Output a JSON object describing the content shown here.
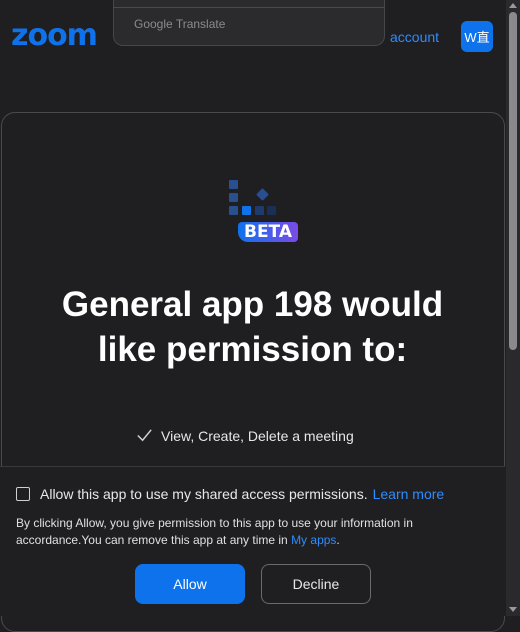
{
  "header": {
    "logo_text": "zoom",
    "translate_label": "Google Translate",
    "account_link": "account",
    "user_badge": "W直"
  },
  "app": {
    "icon": "app-grid-icon",
    "beta_label": "BETA",
    "title_line1": "General app 198 would",
    "title_line2": "like permission to:",
    "permissions": [
      {
        "icon": "check-icon",
        "label": "View, Create, Delete a meeting"
      }
    ]
  },
  "footer": {
    "consent_label": "Allow this app to use my shared access permissions.",
    "learn_more": "Learn more",
    "consent_checked": false,
    "disclaimer_text": "By clicking Allow, you give permission to this app to use your information in accordance.You can remove this app at any time in",
    "my_apps_link": "My apps",
    "disclaimer_end": ".",
    "allow_label": "Allow",
    "decline_label": "Decline"
  },
  "colors": {
    "brand": "#0e72ed",
    "link": "#2d8cff",
    "background": "#1f1f21"
  }
}
